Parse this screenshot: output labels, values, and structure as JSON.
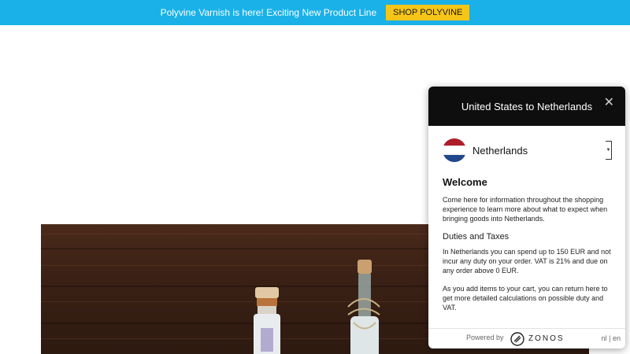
{
  "announcement": {
    "text": "Polyvine Varnish is here! Exciting New Product Line",
    "button": "SHOP POLYVINE",
    "bg_color": "#1ab1e8",
    "button_color": "#f5c518"
  },
  "panel": {
    "title": "United States to Netherlands",
    "close_icon": "close-icon",
    "country": "Netherlands",
    "flag": "netherlands-flag-icon",
    "welcome_heading": "Welcome",
    "welcome_text": "Come here for information throughout the shopping experience to learn more about what to expect when bringing goods into Netherlands.",
    "duties_heading": "Duties and Taxes",
    "duties_text": "In Netherlands you can spend up to 150 EUR and not incur any duty on your order. VAT is 21% and due on any order above 0 EUR.",
    "cart_text": "As you add items to your cart, you can return here to get more detailed calculations on possible duty and VAT.",
    "powered_by": "Powered by",
    "brand": "ZONOS",
    "lang_nl": "nl",
    "lang_sep": "|",
    "lang_en": "en"
  }
}
